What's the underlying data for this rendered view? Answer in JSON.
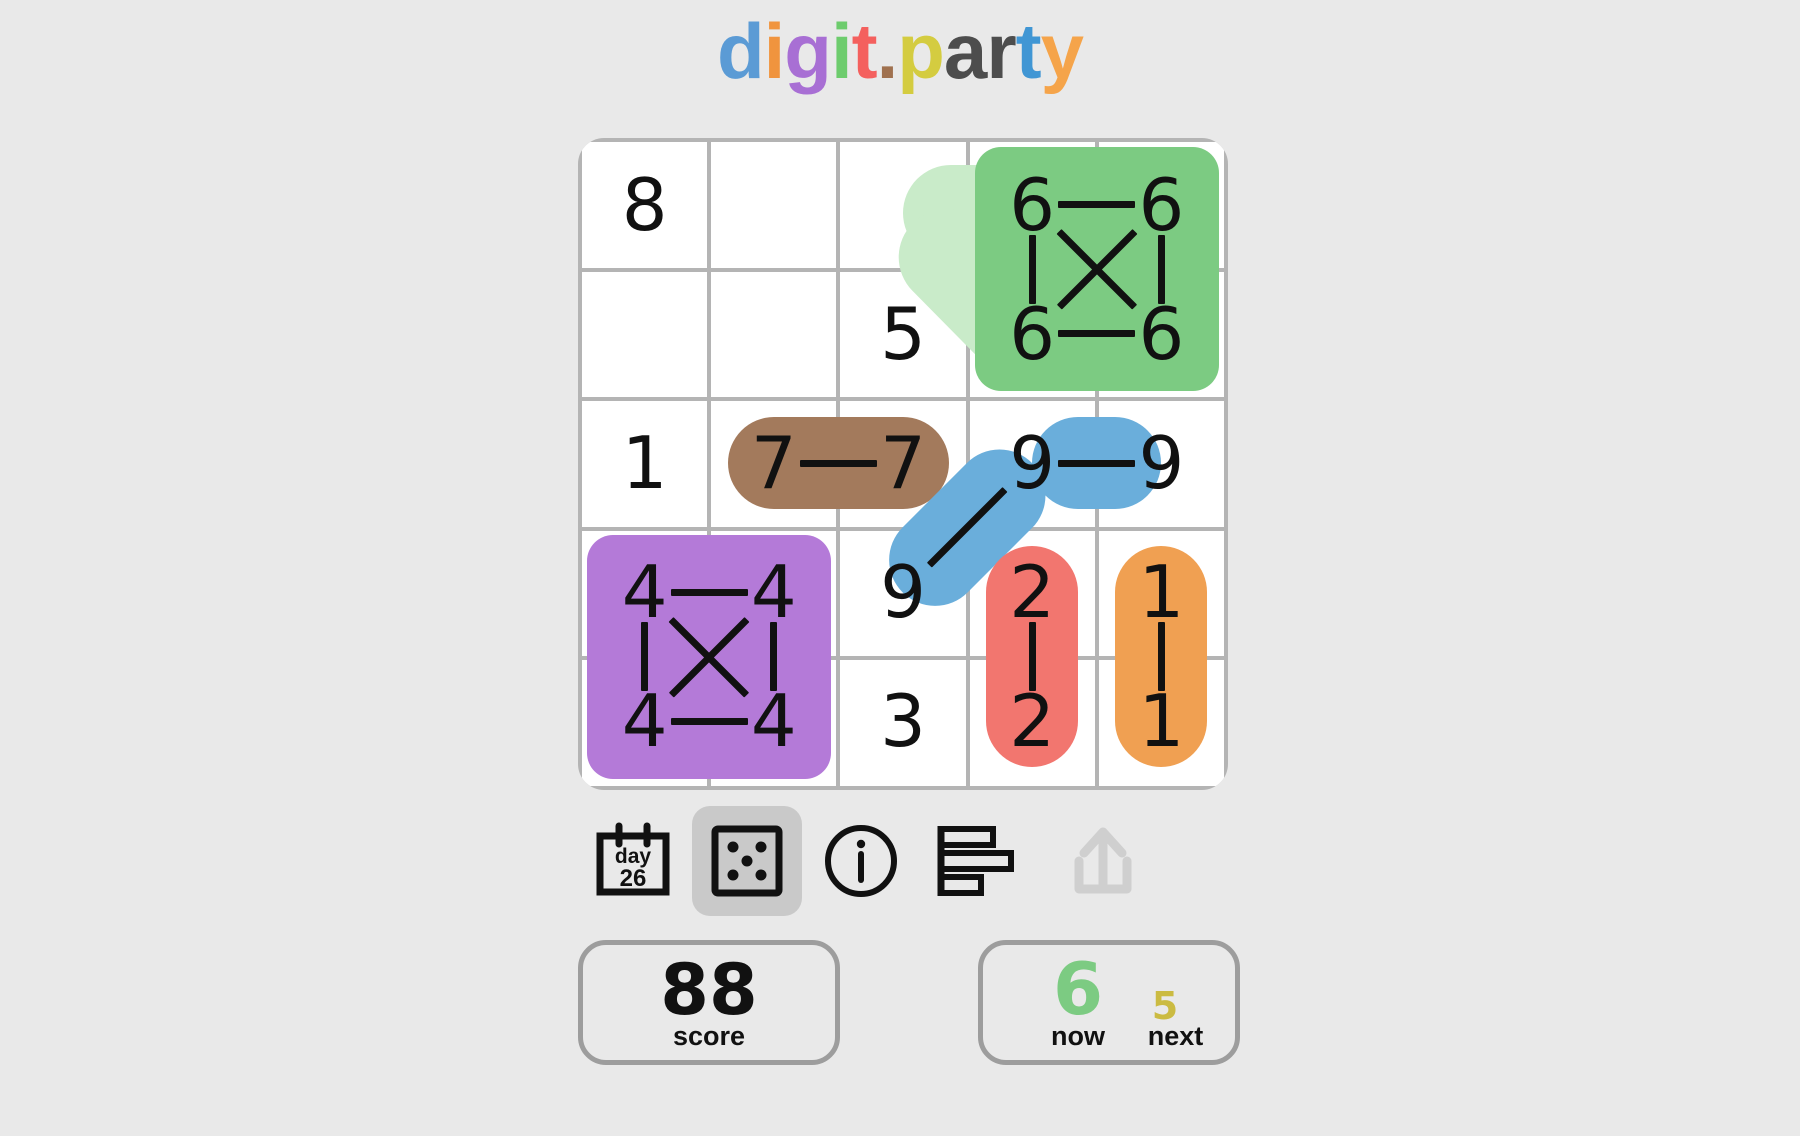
{
  "title": {
    "text": "digit.party",
    "letters": [
      {
        "ch": "d",
        "color": "#5b9bd5"
      },
      {
        "ch": "i",
        "color": "#f0943e"
      },
      {
        "ch": "g",
        "color": "#a86fd4"
      },
      {
        "ch": "i",
        "color": "#6dcc6d"
      },
      {
        "ch": "t",
        "color": "#f4605e"
      },
      {
        "ch": ".",
        "color": "#a0714f"
      },
      {
        "ch": "p",
        "color": "#d4cc40"
      },
      {
        "ch": "a",
        "color": "#4d4d4d"
      },
      {
        "ch": "r",
        "color": "#4d4d4d"
      },
      {
        "ch": "t",
        "color": "#4096d4"
      },
      {
        "ch": "y",
        "color": "#f5a44a"
      }
    ]
  },
  "board": {
    "rows": 5,
    "cols": 5,
    "cells": [
      [
        "8",
        "",
        "",
        "6",
        "6"
      ],
      [
        "",
        "",
        "5",
        "6",
        "6"
      ],
      [
        "1",
        "7",
        "7",
        "9",
        "9"
      ],
      [
        "4",
        "4",
        "9",
        "2",
        "1"
      ],
      [
        "4",
        "4",
        "3",
        "2",
        "1"
      ]
    ],
    "groups": [
      {
        "name": "green-sixes",
        "value": "6",
        "color": "#7ccb82",
        "shape": "block",
        "r0": 0,
        "c0": 3,
        "r1": 1,
        "c1": 4
      },
      {
        "name": "brown-sevens",
        "value": "7",
        "color": "#a37a5c",
        "shape": "row",
        "r0": 2,
        "c0": 1,
        "r1": 2,
        "c1": 2
      },
      {
        "name": "blue-nines",
        "value": "9",
        "color": "#6aaedb",
        "shape": "elbow",
        "r0": 2,
        "c0": 3,
        "r1": 3,
        "c1": 2
      },
      {
        "name": "purple-fours",
        "value": "4",
        "color": "#b47ad8",
        "shape": "block",
        "r0": 3,
        "c0": 0,
        "r1": 4,
        "c1": 1
      },
      {
        "name": "red-twos",
        "value": "2",
        "color": "#f2766f",
        "shape": "col",
        "r0": 3,
        "c0": 3,
        "r1": 4,
        "c1": 3
      },
      {
        "name": "orange-ones",
        "value": "1",
        "color": "#f0a052",
        "shape": "col",
        "r0": 3,
        "c0": 4,
        "r1": 4,
        "c1": 4
      }
    ],
    "preview": {
      "name": "preview-connector",
      "color": "#c9ebc9"
    }
  },
  "toolbar": {
    "items": [
      {
        "name": "calendar-day-icon",
        "label": "day",
        "day": "26",
        "selected": false,
        "disabled": false
      },
      {
        "name": "dice-icon",
        "label": "random",
        "selected": true,
        "disabled": false
      },
      {
        "name": "info-icon",
        "label": "info",
        "selected": false,
        "disabled": false
      },
      {
        "name": "bar-chart-icon",
        "label": "stats",
        "selected": false,
        "disabled": false
      },
      {
        "name": "share-upload-icon",
        "label": "share",
        "selected": false,
        "disabled": true
      }
    ]
  },
  "score_panel": {
    "value": "88",
    "label": "score"
  },
  "next_panel": {
    "now_value": "6",
    "now_color": "#7ccb82",
    "now_label": "now",
    "next_value": "5",
    "next_color": "#cbbb42",
    "next_label": "next"
  }
}
